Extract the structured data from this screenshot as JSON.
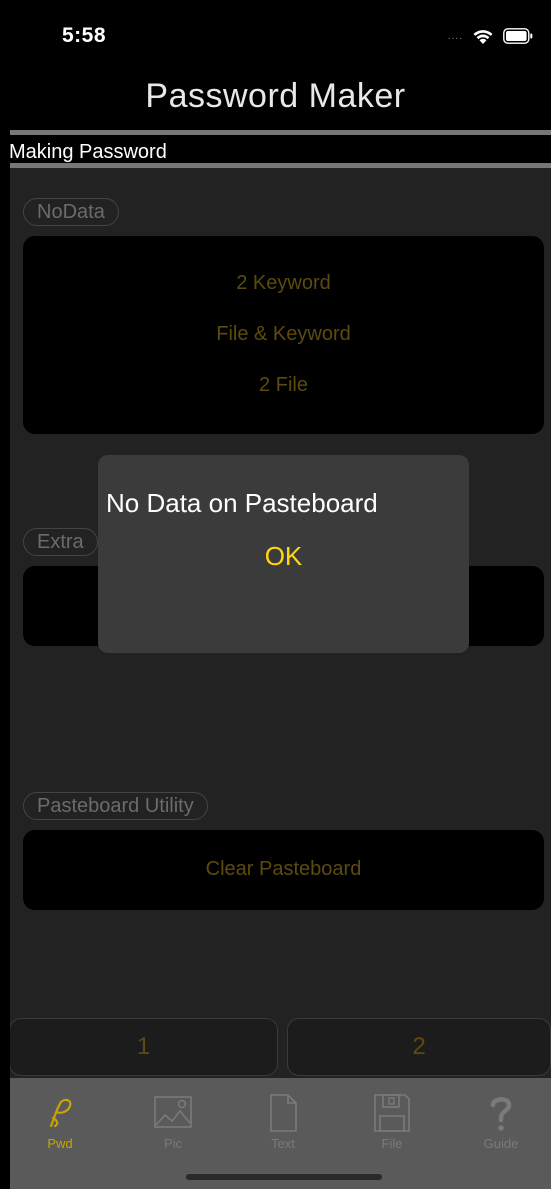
{
  "status_bar": {
    "time": "5:58",
    "signal": "....",
    "wifi_icon": "wifi-icon",
    "battery_icon": "battery-icon"
  },
  "nav": {
    "title": "Password Maker"
  },
  "section": {
    "title": "Making Password"
  },
  "content": {
    "nodata_label": "NoData",
    "modes": [
      "2 Keyword",
      "File & Keyword",
      "2 File"
    ],
    "extra_label": "Extra",
    "pasteboard_label": "Pasteboard Utility",
    "clear_pasteboard": "Clear Pasteboard",
    "segments": [
      "1",
      "2"
    ]
  },
  "alert": {
    "message": "No Data on Pasteboard",
    "ok_label": "OK"
  },
  "tab_bar": {
    "tabs": [
      {
        "label": "Pwd",
        "icon": "script-p-icon",
        "active": true
      },
      {
        "label": "Pic",
        "icon": "picture-icon",
        "active": false
      },
      {
        "label": "Text",
        "icon": "document-icon",
        "active": false
      },
      {
        "label": "File",
        "icon": "floppy-disk-icon",
        "active": false
      },
      {
        "label": "Guide",
        "icon": "question-mark-icon",
        "active": false
      }
    ]
  },
  "colors": {
    "accent": "#ffd60a",
    "dim_accent": "#5c4b0d",
    "alert_bg": "#3b3b3b",
    "tab_bar_bg": "#5a5a5a"
  }
}
